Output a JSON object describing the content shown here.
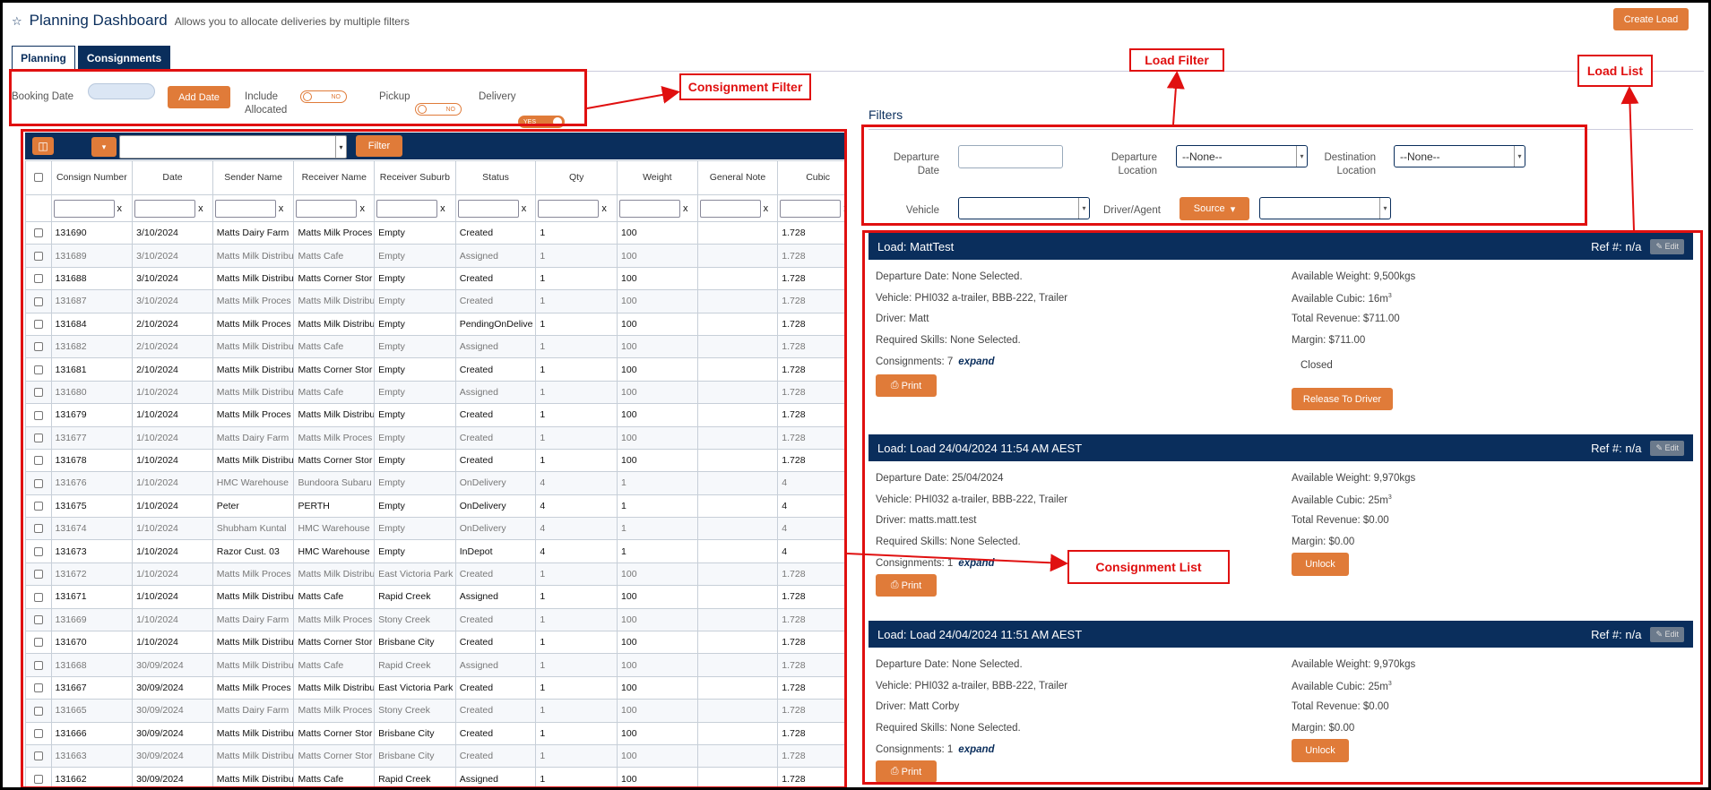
{
  "header": {
    "star_icon": "star-icon",
    "title": "Planning Dashboard",
    "subtitle": "Allows you to allocate deliveries by multiple filters",
    "create_load": "Create Load"
  },
  "tabs": [
    {
      "label": "Planning"
    },
    {
      "label": "Consignments"
    }
  ],
  "consignment_filter": {
    "booking_date_label": "Booking Date",
    "add_date": "Add Date",
    "include_allocated_label": "Include Allocated",
    "include_allocated_state": "NO",
    "pickup_label": "Pickup",
    "pickup_state": "NO",
    "delivery_label": "Delivery",
    "delivery_state": "YES"
  },
  "callouts": {
    "consignment_filter": "Consignment Filter",
    "load_filter": "Load Filter",
    "load_list": "Load List",
    "consignment_list": "Consignment List"
  },
  "table_toolbar": {
    "filter": "Filter"
  },
  "table": {
    "columns": [
      "Consign Number",
      "Date",
      "Sender Name",
      "Receiver Name",
      "Receiver Suburb",
      "Status",
      "Qty",
      "Weight",
      "General Note",
      "Cubic"
    ],
    "rows": [
      [
        "131690",
        "3/10/2024",
        "Matts Dairy Farm",
        "Matts Milk Proces",
        "Empty",
        "Created",
        "1",
        "100",
        "",
        "1.728"
      ],
      [
        "131689",
        "3/10/2024",
        "Matts Milk Distribu",
        "Matts Cafe",
        "Empty",
        "Assigned",
        "1",
        "100",
        "",
        "1.728"
      ],
      [
        "131688",
        "3/10/2024",
        "Matts Milk Distribu",
        "Matts Corner Stor",
        "Empty",
        "Created",
        "1",
        "100",
        "",
        "1.728"
      ],
      [
        "131687",
        "3/10/2024",
        "Matts Milk Proces",
        "Matts Milk Distribu",
        "Empty",
        "Created",
        "1",
        "100",
        "",
        "1.728"
      ],
      [
        "131684",
        "2/10/2024",
        "Matts Milk Proces",
        "Matts Milk Distribu",
        "Empty",
        "PendingOnDelive",
        "1",
        "100",
        "",
        "1.728"
      ],
      [
        "131682",
        "2/10/2024",
        "Matts Milk Distribu",
        "Matts Cafe",
        "Empty",
        "Assigned",
        "1",
        "100",
        "",
        "1.728"
      ],
      [
        "131681",
        "2/10/2024",
        "Matts Milk Distribu",
        "Matts Corner Stor",
        "Empty",
        "Created",
        "1",
        "100",
        "",
        "1.728"
      ],
      [
        "131680",
        "1/10/2024",
        "Matts Milk Distribu",
        "Matts Cafe",
        "Empty",
        "Assigned",
        "1",
        "100",
        "",
        "1.728"
      ],
      [
        "131679",
        "1/10/2024",
        "Matts Milk Proces",
        "Matts Milk Distribu",
        "Empty",
        "Created",
        "1",
        "100",
        "",
        "1.728"
      ],
      [
        "131677",
        "1/10/2024",
        "Matts Dairy Farm",
        "Matts Milk Proces",
        "Empty",
        "Created",
        "1",
        "100",
        "",
        "1.728"
      ],
      [
        "131678",
        "1/10/2024",
        "Matts Milk Distribu",
        "Matts Corner Stor",
        "Empty",
        "Created",
        "1",
        "100",
        "",
        "1.728"
      ],
      [
        "131676",
        "1/10/2024",
        "HMC Warehouse",
        "Bundoora Subaru",
        "Empty",
        "OnDelivery",
        "4",
        "1",
        "",
        "4"
      ],
      [
        "131675",
        "1/10/2024",
        "Peter",
        "PERTH",
        "Empty",
        "OnDelivery",
        "4",
        "1",
        "",
        "4"
      ],
      [
        "131674",
        "1/10/2024",
        "Shubham Kuntal",
        "HMC Warehouse",
        "Empty",
        "OnDelivery",
        "4",
        "1",
        "",
        "4"
      ],
      [
        "131673",
        "1/10/2024",
        "Razor Cust. 03",
        "HMC Warehouse",
        "Empty",
        "InDepot",
        "4",
        "1",
        "",
        "4"
      ],
      [
        "131672",
        "1/10/2024",
        "Matts Milk Proces",
        "Matts Milk Distribu",
        "East Victoria Park",
        "Created",
        "1",
        "100",
        "",
        "1.728"
      ],
      [
        "131671",
        "1/10/2024",
        "Matts Milk Distribu",
        "Matts Cafe",
        "Rapid Creek",
        "Assigned",
        "1",
        "100",
        "",
        "1.728"
      ],
      [
        "131669",
        "1/10/2024",
        "Matts Dairy Farm",
        "Matts Milk Proces",
        "Stony Creek",
        "Created",
        "1",
        "100",
        "",
        "1.728"
      ],
      [
        "131670",
        "1/10/2024",
        "Matts Milk Distribu",
        "Matts Corner Stor",
        "Brisbane City",
        "Created",
        "1",
        "100",
        "",
        "1.728"
      ],
      [
        "131668",
        "30/09/2024",
        "Matts Milk Distribu",
        "Matts Cafe",
        "Rapid Creek",
        "Assigned",
        "1",
        "100",
        "",
        "1.728"
      ],
      [
        "131667",
        "30/09/2024",
        "Matts Milk Proces",
        "Matts Milk Distribu",
        "East Victoria Park",
        "Created",
        "1",
        "100",
        "",
        "1.728"
      ],
      [
        "131665",
        "30/09/2024",
        "Matts Dairy Farm",
        "Matts Milk Proces",
        "Stony Creek",
        "Created",
        "1",
        "100",
        "",
        "1.728"
      ],
      [
        "131666",
        "30/09/2024",
        "Matts Milk Distribu",
        "Matts Corner Stor",
        "Brisbane City",
        "Created",
        "1",
        "100",
        "",
        "1.728"
      ],
      [
        "131663",
        "30/09/2024",
        "Matts Milk Distribu",
        "Matts Corner Stor",
        "Brisbane City",
        "Created",
        "1",
        "100",
        "",
        "1.728"
      ],
      [
        "131662",
        "30/09/2024",
        "Matts Milk Distribu",
        "Matts Cafe",
        "Rapid Creek",
        "Assigned",
        "1",
        "100",
        "",
        "1.728"
      ]
    ]
  },
  "load_filters": {
    "heading": "Filters",
    "departure_date": "Departure Date",
    "departure_location": "Departure Location",
    "destination_location": "Destination Location",
    "vehicle": "Vehicle",
    "driver_agent": "Driver/Agent",
    "source": "Source",
    "none_option": "--None--"
  },
  "loads": [
    {
      "title": "Load: MattTest",
      "ref": "Ref #: n/a",
      "edit": "Edit",
      "departure": "Departure Date: None Selected.",
      "vehicle": "Vehicle: PHI032 a-trailer, BBB-222, Trailer",
      "driver": "Driver: Matt",
      "skills": "Required Skills: None Selected.",
      "consignments": "Consignments: 7",
      "expand": "expand",
      "weight": "Available Weight: 9,500kgs",
      "cubic": "Available Cubic: 16m",
      "cubic_sup": "3",
      "revenue": "Total Revenue: $711.00",
      "margin": "Margin: $711.00",
      "closed_label": "Closed",
      "closed_state": "YES",
      "print": "Print",
      "action": "Release To Driver"
    },
    {
      "title": "Load: Load 24/04/2024 11:54 AM AEST",
      "ref": "Ref #: n/a",
      "edit": "Edit",
      "departure": "Departure Date: 25/04/2024",
      "vehicle": "Vehicle: PHI032 a-trailer, BBB-222, Trailer",
      "driver": "Driver: matts.matt.test",
      "skills": "Required Skills: None Selected.",
      "consignments": "Consignments: 1",
      "expand": "expand",
      "weight": "Available Weight: 9,970kgs",
      "cubic": "Available Cubic: 25m",
      "cubic_sup": "3",
      "revenue": "Total Revenue: $0.00",
      "margin": "Margin: $0.00",
      "print": "Print",
      "action": "Unlock"
    },
    {
      "title": "Load: Load 24/04/2024 11:51 AM AEST",
      "ref": "Ref #: n/a",
      "edit": "Edit",
      "departure": "Departure Date: None Selected.",
      "vehicle": "Vehicle: PHI032 a-trailer, BBB-222, Trailer",
      "driver": "Driver: Matt Corby",
      "skills": "Required Skills: None Selected.",
      "consignments": "Consignments: 1",
      "expand": "expand",
      "weight": "Available Weight: 9,970kgs",
      "cubic": "Available Cubic: 25m",
      "cubic_sup": "3",
      "revenue": "Total Revenue: $0.00",
      "margin": "Margin: $0.00",
      "print": "Print",
      "action": "Unlock"
    }
  ],
  "colors": {
    "navy": "#0a2e5c",
    "orange": "#e07b39",
    "annotation_red": "#e01010"
  }
}
